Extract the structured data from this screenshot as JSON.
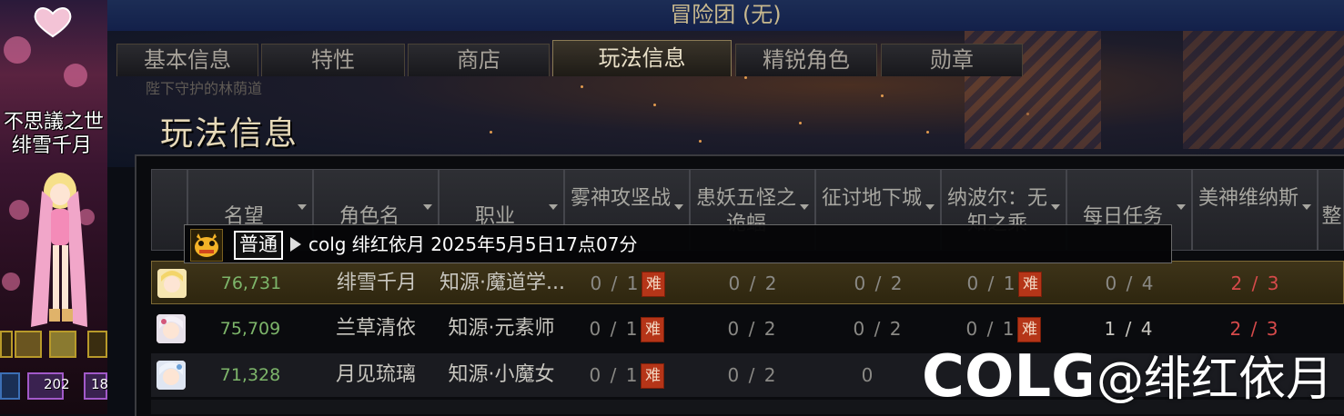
{
  "window_title": "冒险团 (无)",
  "tabs": [
    {
      "label": "基本信息",
      "active": false
    },
    {
      "label": "特性",
      "active": false
    },
    {
      "label": "商店",
      "active": false
    },
    {
      "label": "玩法信息",
      "active": true
    },
    {
      "label": "精锐角色",
      "active": false
    },
    {
      "label": "勋章",
      "active": false
    }
  ],
  "page_title": "玩法信息",
  "background_caption": "陛下守护的林荫道",
  "left_panel": {
    "name_line1": "不思議之世",
    "name_line2": "绯雪千月",
    "skill_counts": [
      "202",
      "18"
    ]
  },
  "columns": [
    {
      "label": "名望"
    },
    {
      "label": "角色名"
    },
    {
      "label": "职业"
    },
    {
      "label": "雾神攻坚战"
    },
    {
      "label": "患妖五怪之诡蝠"
    },
    {
      "label": "征讨地下城"
    },
    {
      "label": "纳波尔：无知之乘"
    },
    {
      "label": "每日任务"
    },
    {
      "label": "美神维纳斯"
    },
    {
      "label": "整"
    }
  ],
  "tooltip": {
    "badge": "普通",
    "text": "colg 绯红依月 2025年5月5日17点07分"
  },
  "hard_label": "难",
  "rows": [
    {
      "fame": "76,731",
      "name": "绯雪千月",
      "job": "知源·魔道学...",
      "c1": "0 / 1",
      "c2": "0 / 2",
      "c3": "0 / 2",
      "c4": "0 / 1",
      "daily": "0 / 4",
      "venus": "2 / 3",
      "selected": true
    },
    {
      "fame": "75,709",
      "name": "兰草清依",
      "job": "知源·元素师",
      "c1": "0 / 1",
      "c2": "0 / 2",
      "c3": "0 / 2",
      "c4": "0 / 1",
      "daily": "1 / 4",
      "venus": "2 / 3",
      "selected": false
    },
    {
      "fame": "71,328",
      "name": "月见琉璃",
      "job": "知源·小魔女",
      "c1": "0 / 1",
      "c2": "0 / 2",
      "c3": "0",
      "c4": "",
      "daily": "",
      "venus": "",
      "selected": false
    }
  ],
  "watermark": {
    "logo": "COLG",
    "text": "@绯红依月"
  },
  "colors": {
    "fame": "#7db56a",
    "venus": "#d64a4a",
    "hard_badge": "#b53518",
    "selected_row": "#3e3419"
  }
}
